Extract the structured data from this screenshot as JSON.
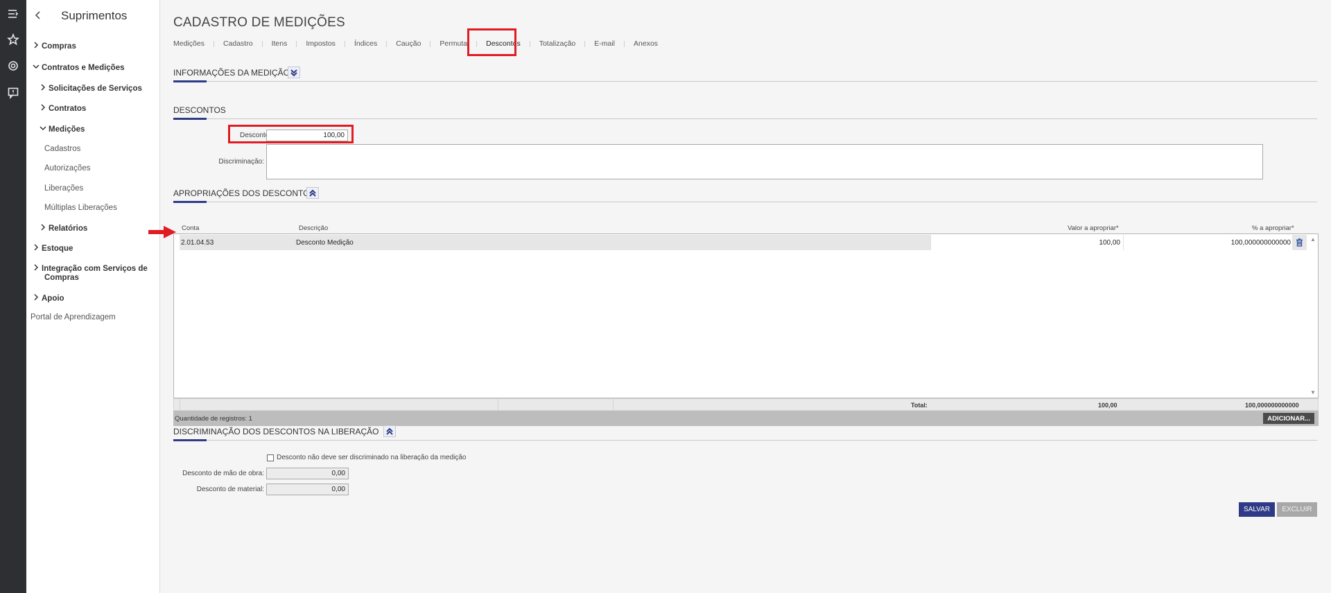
{
  "rail": {
    "icons": [
      "menu-icon",
      "star-icon",
      "gear-icon",
      "feedback-icon"
    ]
  },
  "sidebar": {
    "title": "Suprimentos",
    "items": [
      {
        "label": "Compras",
        "level": 0,
        "expanded": false
      },
      {
        "label": "Contratos e Medições",
        "level": 0,
        "expanded": true
      },
      {
        "label": "Solicitações de Serviços",
        "level": 1,
        "expanded": false
      },
      {
        "label": "Contratos",
        "level": 1,
        "expanded": false
      },
      {
        "label": "Medições",
        "level": 1,
        "expanded": true
      },
      {
        "label": "Cadastros",
        "level": 2
      },
      {
        "label": "Autorizações",
        "level": 2
      },
      {
        "label": "Liberações",
        "level": 2
      },
      {
        "label": "Múltiplas Liberações",
        "level": 2
      },
      {
        "label": "Relatórios",
        "level": 1,
        "expanded": false
      },
      {
        "label": "Estoque",
        "level": 0,
        "expanded": false
      },
      {
        "label": "Integração com Serviços de",
        "label2": "Compras",
        "level": 0,
        "expanded": false
      },
      {
        "label": "Apoio",
        "level": 0,
        "expanded": false
      },
      {
        "label": "Portal de Aprendizagem",
        "level": -1
      }
    ]
  },
  "page": {
    "title": "CADASTRO DE MEDIÇÕES",
    "tabs": [
      "Medições",
      "Cadastro",
      "Itens",
      "Impostos",
      "Índices",
      "Caução",
      "Permuta",
      "Descontos",
      "Totalização",
      "E-mail",
      "Anexos"
    ],
    "active_tab": "Descontos"
  },
  "sections": {
    "info": "INFORMAÇÕES DA MEDIÇÃO",
    "descontos": "DESCONTOS",
    "apropriacoes": "APROPRIAÇÕES DOS DESCONTOS",
    "discriminacao": "DISCRIMINAÇÃO DOS DESCONTOS NA LIBERAÇÃO"
  },
  "form": {
    "desconto_label": "Desconto:",
    "desconto_value": "100,00",
    "discriminacao_label": "Discriminação:",
    "discriminacao_value": ""
  },
  "grid": {
    "headers": {
      "conta": "Conta",
      "descricao": "Descrição",
      "valor": "Valor a apropriar*",
      "percent": "% a apropriar*"
    },
    "rows": [
      {
        "conta": "2.01.04.53",
        "descricao": "Desconto Medição",
        "valor": "100,00",
        "percent": "100,000000000000"
      }
    ],
    "total_label": "Total:",
    "total_valor": "100,00",
    "total_percent": "100,000000000000",
    "count_label": "Quantidade de registros: 1",
    "add_button": "ADICIONAR..."
  },
  "liberacao": {
    "checkbox_label": "Desconto não deve ser discriminado na liberação da medição",
    "checkbox_checked": false,
    "mao_obra_label": "Desconto de mão de obra:",
    "mao_obra_value": "0,00",
    "material_label": "Desconto de material:",
    "material_value": "0,00"
  },
  "actions": {
    "save": "SALVAR",
    "delete": "EXCLUIR"
  },
  "colors": {
    "accent": "#2e3a87",
    "highlight": "#e11b22",
    "rail": "#2d2f33"
  }
}
